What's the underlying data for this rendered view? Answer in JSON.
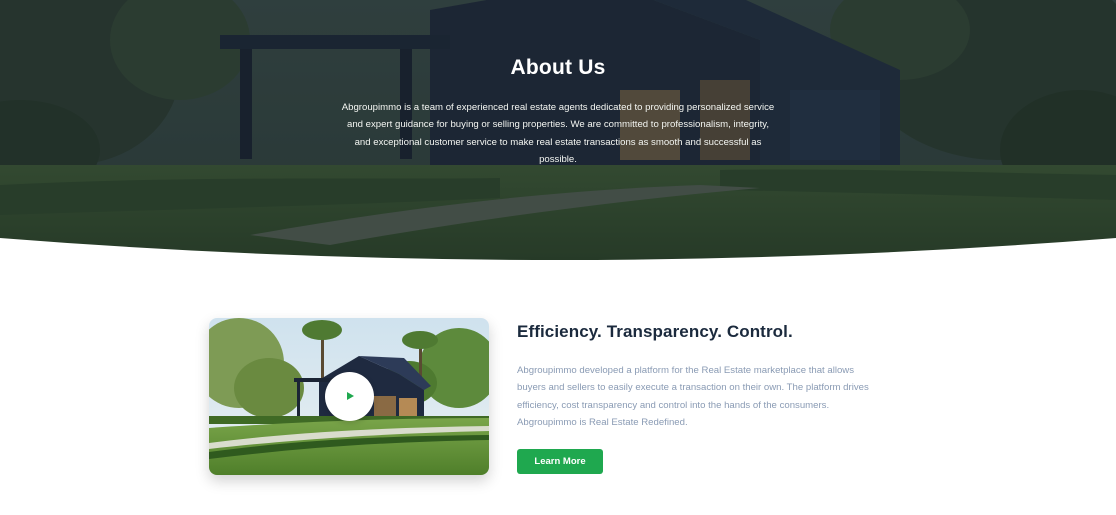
{
  "hero": {
    "title": "About Us",
    "description": "Abgroupimmo is a team of experienced real estate agents dedicated to providing personalized service and expert guidance for buying or selling properties. We are committed to professionalism, integrity, and exceptional customer service to make real estate transactions as smooth and successful as possible."
  },
  "feature": {
    "title": "Efficiency. Transparency. Control.",
    "description": "Abgroupimmo developed a platform for the Real Estate marketplace that allows buyers and sellers to easily execute a transaction on their own. The platform drives efficiency, cost transparency and control into the hands of the consumers. Abgroupimmo is Real Estate Redefined.",
    "button_label": "Learn More",
    "play_icon": "play-icon"
  },
  "colors": {
    "accent": "#1fa84f",
    "heading": "#1b2a3d",
    "body_text": "#8a9bb4",
    "hero_overlay": "#1e2b36"
  }
}
